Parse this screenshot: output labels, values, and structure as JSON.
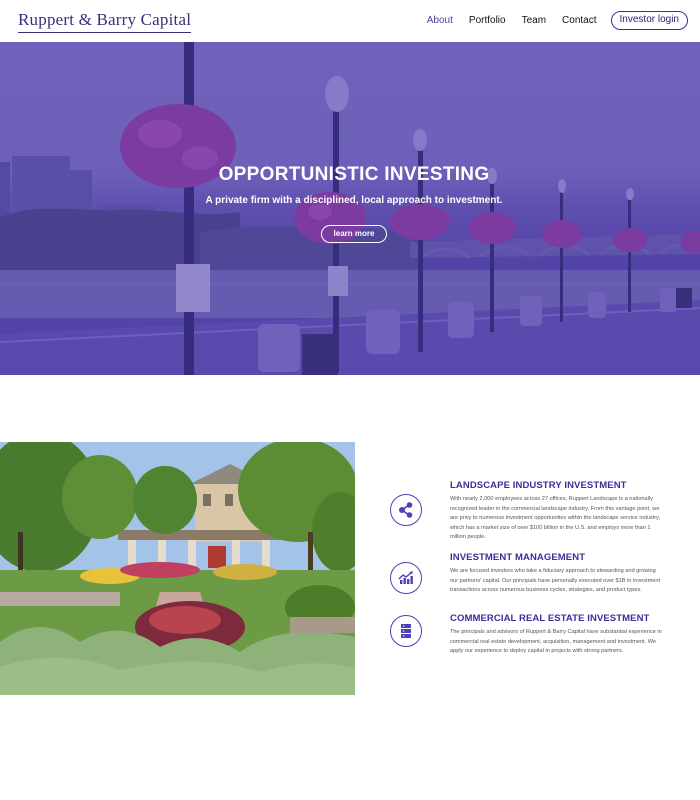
{
  "header": {
    "logo_text": "Ruppert & Barry Capital",
    "nav": [
      {
        "label": "About",
        "active": true
      },
      {
        "label": "Portfolio"
      },
      {
        "label": "Team"
      },
      {
        "label": "Contact"
      }
    ],
    "login_label": "Investor login"
  },
  "hero": {
    "title": "OPPORTUNISTIC INVESTING",
    "subtitle": "A private firm with a disciplined, local approach to investment.",
    "button_label": "learn more"
  },
  "features": [
    {
      "icon": "share-network-icon",
      "title": "LANDSCAPE INDUSTRY INVESTMENT",
      "body": "With nearly 2,000 employees across 27 offices, Ruppert Landscape is a nationally recognized leader in the commercial landscape industry. From this vantage point, we are privy to numerous investment opportunities within the landscape service industry, which has a market size of over $100 billion in the U.S. and employs more than 1 million people."
    },
    {
      "icon": "growth-chart-icon",
      "title": "INVESTMENT MANAGEMENT",
      "body": "We are focused investors who take a fiduciary approach to stewarding and growing our partners' capital. Our principals have personally executed over $1B in investment transactions across numerous business cycles, strategies, and product types."
    },
    {
      "icon": "building-stack-icon",
      "title": "COMMERCIAL REAL ESTATE INVESTMENT",
      "body": "The principals and advisors of Ruppert & Barry Capital have substantial experience in commercial real estate development, acquisition, management and investment. We apply our experience to deploy capital in projects with strong partners."
    }
  ],
  "colors": {
    "brand": "#3a2f7a",
    "accent": "#4d40b6",
    "hero_overlay": "#4834aa"
  }
}
